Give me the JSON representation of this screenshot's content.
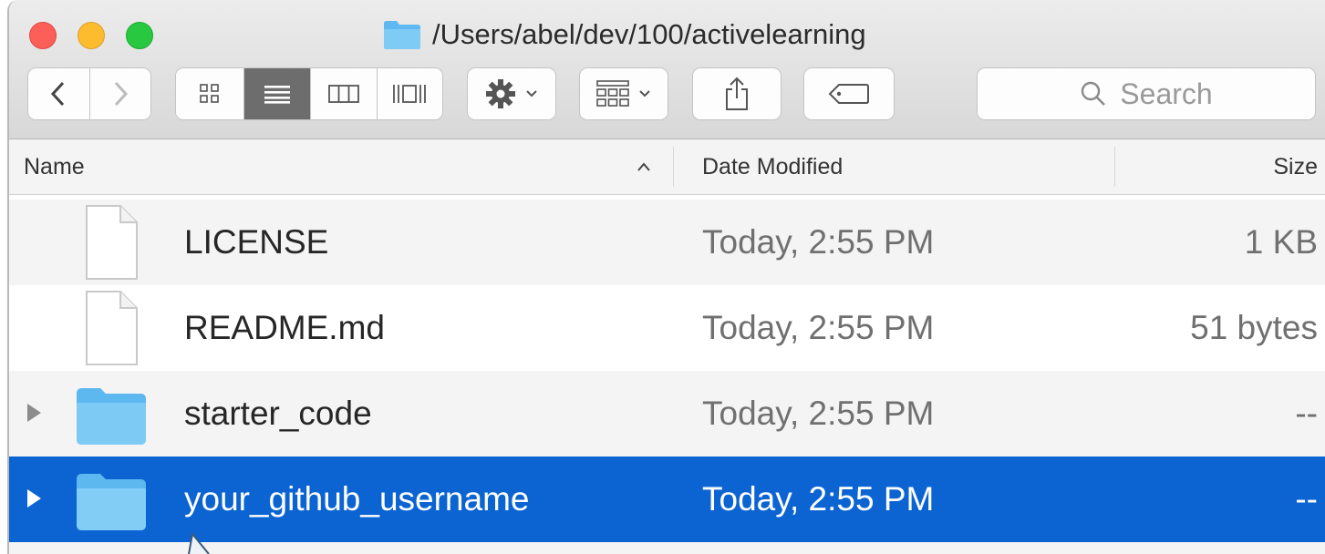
{
  "window": {
    "path": "/Users/abel/dev/100/activelearning"
  },
  "toolbar": {
    "back_icon": "chevron-left-icon",
    "forward_icon": "chevron-right-icon",
    "views": [
      "icon-view-icon",
      "list-view-icon",
      "column-view-icon",
      "cover-flow-icon"
    ],
    "active_view": "list-view-icon",
    "action_icon": "gear-icon",
    "arrange_icon": "grid-icon",
    "share_icon": "share-icon",
    "tag_icon": "tag-icon",
    "search_placeholder": "Search"
  },
  "columns": {
    "name": "Name",
    "date": "Date Modified",
    "size": "Size"
  },
  "files": [
    {
      "name": "LICENSE",
      "date": "Today, 2:55 PM",
      "size": "1 KB",
      "kind": "document",
      "selected": false
    },
    {
      "name": "README.md",
      "date": "Today, 2:55 PM",
      "size": "51 bytes",
      "kind": "document",
      "selected": false
    },
    {
      "name": "starter_code",
      "date": "Today, 2:55 PM",
      "size": "--",
      "kind": "folder",
      "selected": false
    },
    {
      "name": "your_github_username",
      "date": "Today, 2:55 PM",
      "size": "--",
      "kind": "folder",
      "selected": true
    }
  ],
  "colors": {
    "selection": "#0b64d2",
    "folder": "#6fc3f3"
  }
}
